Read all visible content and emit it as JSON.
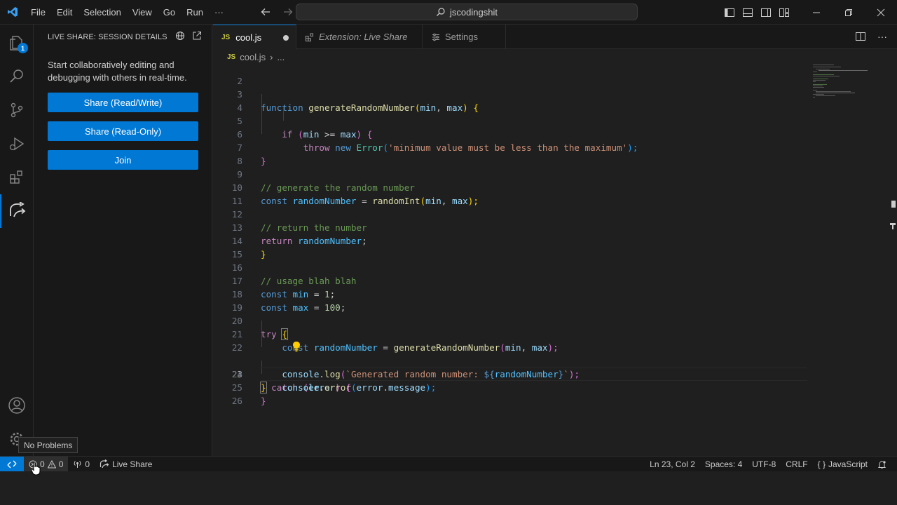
{
  "menu": [
    "File",
    "Edit",
    "Selection",
    "View",
    "Go",
    "Run",
    "···"
  ],
  "search": {
    "text": "jscodingshit"
  },
  "activity": {
    "explorer_badge": "1"
  },
  "sidebar": {
    "title": "LIVE SHARE: SESSION DETAILS",
    "description": "Start collaboratively editing and debugging with others in real-time.",
    "buttons": [
      "Share (Read/Write)",
      "Share (Read-Only)",
      "Join"
    ]
  },
  "tabs": [
    {
      "icon": "JS",
      "label": "cool.js"
    },
    {
      "label": "Extension: Live Share"
    },
    {
      "label": "Settings"
    }
  ],
  "breadcrumb": {
    "icon": "JS",
    "file": "cool.js",
    "rest": "..."
  },
  "line_numbers": [
    "2",
    "3",
    "4",
    "5",
    "6",
    "7",
    "8",
    "9",
    "10",
    "11",
    "12",
    "13",
    "14",
    "15",
    "16",
    "17",
    "18",
    "19",
    "20",
    "21",
    "22",
    "23",
    "24",
    "25",
    "26"
  ],
  "code": {
    "l3": {
      "kw": "function ",
      "fn": "generateRandomNumber",
      "p1": "(",
      "a": "min",
      "c": ", ",
      "b": "max",
      "p2": ") ",
      "br": "{"
    },
    "l5": {
      "kw": "if ",
      "p1": "(",
      "a": "min",
      "op": " >= ",
      "b": "max",
      "p2": ") ",
      "br": "{"
    },
    "l6": {
      "kw": "throw ",
      "kw2": "new ",
      "cls": "Error",
      "p1": "(",
      "str": "'minimum value must be less than the maximum'",
      "p2": ");"
    },
    "l7": {
      "br": "}"
    },
    "l9": {
      "cmt": "// generate the random number"
    },
    "l10": {
      "kw": "const ",
      "v": "randomNumber",
      "op": " = ",
      "fn": "randomInt",
      "p1": "(",
      "a": "min",
      "c": ", ",
      "b": "max",
      "p2": ");"
    },
    "l12": {
      "cmt": "// return the number"
    },
    "l13": {
      "kw": "return ",
      "v": "randomNumber",
      "end": ";"
    },
    "l14": {
      "br": "}"
    },
    "l16": {
      "cmt": "// usage blah blah"
    },
    "l17": {
      "kw": "const ",
      "v": "min",
      "op": " = ",
      "num": "1",
      "end": ";"
    },
    "l18": {
      "kw": "const ",
      "v": "max",
      "op": " = ",
      "num": "100",
      "end": ";"
    },
    "l20": {
      "kw": "try ",
      "br": "{"
    },
    "l21": {
      "kw": "const ",
      "v": "randomNumber",
      "op": " = ",
      "fn": "generateRandomNumber",
      "p1": "(",
      "a": "min",
      "c": ", ",
      "b": "max",
      "p2": ");"
    },
    "l22": {
      "obj": "console",
      "dot": ".",
      "fn": "log",
      "p1": "(",
      "s1": "`Generated random number: ",
      "t1": "${",
      "v": "randomNumber",
      "t2": "}",
      "s2": "`",
      "p2": ");"
    },
    "l23": {
      "br": "}",
      "kw": " catch ",
      "p1": "(",
      "v": "error",
      "p2": ") ",
      "br2": "{"
    },
    "l24": {
      "obj": "console",
      "dot": ".",
      "fn": "error",
      "p1": "(",
      "v": "error",
      "dot2": ".",
      "prop": "message",
      "p2": ");"
    },
    "l25": {
      "br": "}"
    }
  },
  "statusbar": {
    "errors": "0",
    "warnings": "0",
    "ports": "0",
    "liveshare": "Live Share",
    "position": "Ln 23, Col 2",
    "spaces": "Spaces: 4",
    "encoding": "UTF-8",
    "eol": "CRLF",
    "language_icon": "{ }",
    "language": "JavaScript"
  },
  "tooltip": "No Problems",
  "colors": {
    "accent": "#0078d4",
    "keyword": "#569cd6",
    "control": "#c586c0",
    "function": "#dcdcaa",
    "variable": "#9cdcfe",
    "string": "#ce9178",
    "comment": "#6a9955",
    "number": "#b5cea8"
  }
}
